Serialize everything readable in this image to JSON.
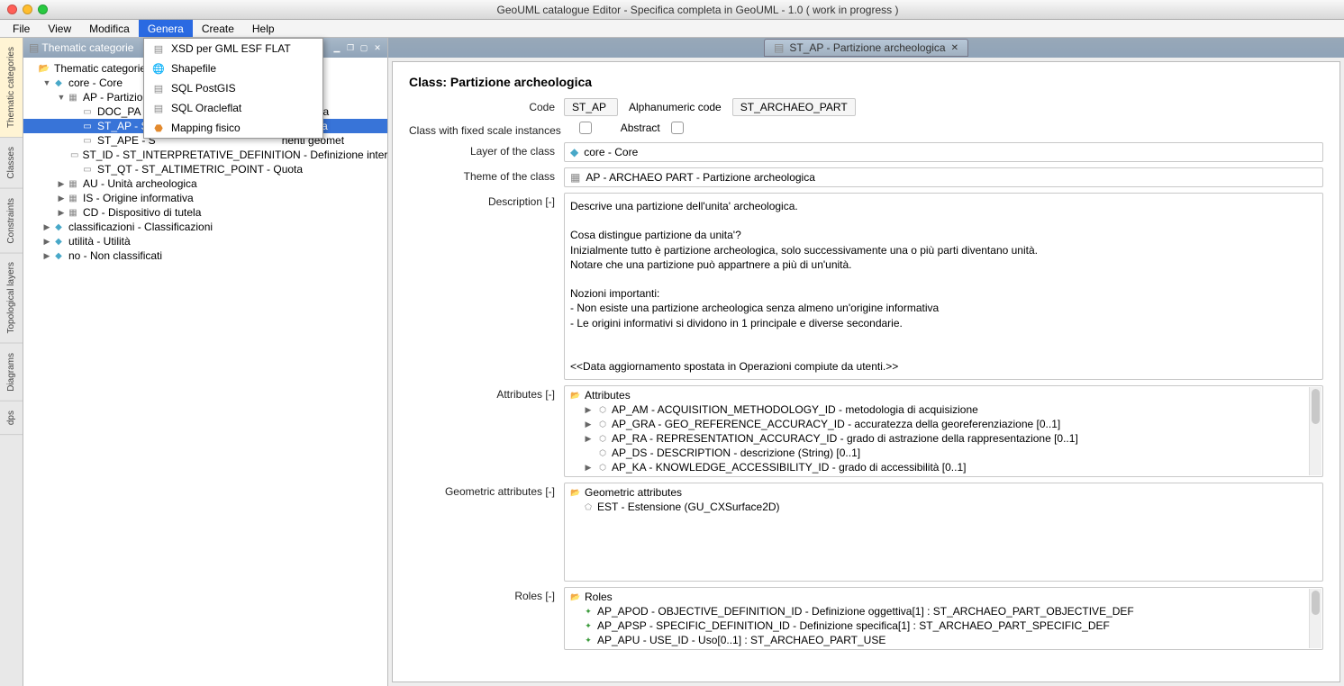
{
  "title": "GeoUML catalogue Editor - Specifica completa in GeoUML - 1.0 ( work in progress )",
  "menu": {
    "file": "File",
    "view": "View",
    "modifica": "Modifica",
    "genera": "Genera",
    "create": "Create",
    "help": "Help"
  },
  "dropdown": {
    "xsd": "XSD per GML ESF FLAT",
    "shapefile": "Shapefile",
    "sqlpostgis": "SQL PostGIS",
    "sqloracle": "SQL Oracleflat",
    "mapping": "Mapping fisico"
  },
  "lefttabs": {
    "thematic": "Thematic categories",
    "classes": "Classes",
    "constraints": "Constraints",
    "topo": "Topological layers",
    "diagrams": "Diagrams",
    "dps": "dps"
  },
  "tree": {
    "header": "Thematic categorie",
    "root": "Thematic categories",
    "core": "core - Core",
    "ap": "AP - Partizione",
    "docpa": "DOC_PA - ",
    "docpa_tail": "mento della",
    "stap": "ST_AP - ST",
    "stap_tail": "gica",
    "stape": "ST_APE - S",
    "stape_tail": "nenti geomet",
    "stid": "ST_ID - ST_INTERPRETATIVE_DEFINITION - Definizione interpr",
    "stqt": "ST_QT - ST_ALTIMETRIC_POINT - Quota",
    "au": "AU - Unità archeologica",
    "is": "IS - Origine informativa",
    "cd": "CD - Dispositivo di tutela",
    "class": "classificazioni - Classificazioni",
    "util": "utilità - Utilità",
    "no": "no - Non classificati"
  },
  "tab": {
    "title": "ST_AP - Partizione archeologica"
  },
  "form": {
    "classTitle": "Class: Partizione archeologica",
    "codeLabel": "Code",
    "codeValue": "ST_AP",
    "alphaLabel": "Alphanumeric code",
    "alphaValue": "ST_ARCHAEO_PART",
    "fixedScaleLabel": "Class with fixed scale instances",
    "abstractLabel": "Abstract",
    "layerLabel": "Layer of the class",
    "layerValue": "core - Core",
    "themeLabel": "Theme of the class",
    "themeValue": "AP - ARCHAEO PART - Partizione archeologica",
    "descLabel": "Description [-]",
    "descValue": "Descrive una partizione dell'unita' archeologica.\n\nCosa distingue partizione da unita'?\nInizialmente tutto è partizione archeologica, solo successivamente una o più parti diventano unità.\nNotare che una partizione può appartnere a più di un'unità.\n\nNozioni importanti:\n- Non esiste una partizione archeologica senza almeno un'origine informativa\n- Le origini informativi si dividono in 1 principale e diverse secondarie.\n\n\n<<Data aggiornamento spostata in Operazioni compiute da utenti.>>",
    "attrLabel": "Attributes [-]",
    "attrHead": "Attributes",
    "attrs": [
      "AP_AM - ACQUISITION_METHODOLOGY_ID - metodologia di acquisizione",
      "AP_GRA - GEO_REFERENCE_ACCURACY_ID - accuratezza della georeferenziazione [0..1]",
      "AP_RA - REPRESENTATION_ACCURACY_ID - grado di astrazione della rappresentazione [0..1]",
      "AP_DS - DESCRIPTION - descrizione (String) [0..1]",
      "AP_KA - KNOWLEDGE_ACCESSIBILITY_ID - grado di accessibilità [0..1]"
    ],
    "geomLabel": "Geometric attributes [-]",
    "geomHead": "Geometric attributes",
    "geomItem": "EST - Estensione (GU_CXSurface2D)",
    "rolesLabel": "Roles [-]",
    "rolesHead": "Roles",
    "roles": [
      "AP_APOD - OBJECTIVE_DEFINITION_ID - Definizione oggettiva[1] : ST_ARCHAEO_PART_OBJECTIVE_DEF",
      "AP_APSP - SPECIFIC_DEFINITION_ID - Definizione specifica[1] : ST_ARCHAEO_PART_SPECIFIC_DEF",
      "AP_APU - USE_ID - Uso[0..1] : ST_ARCHAEO_PART_USE"
    ]
  }
}
